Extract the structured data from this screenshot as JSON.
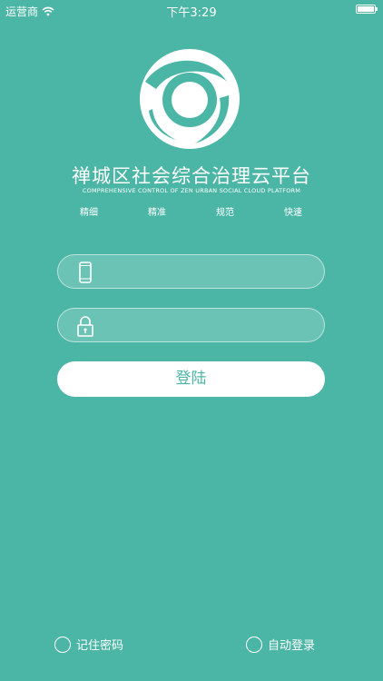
{
  "status_bar": {
    "carrier": "运营商",
    "time": "下午3:29",
    "icons": [
      "wifi-icon",
      "battery-icon"
    ]
  },
  "header": {
    "logo_icon": "eye-swirl-logo",
    "title": "禅城区社会综合治理云平台",
    "subtitle": "COMPREHENSIVE CONTROL OF ZEN URBAN SOCIAL CLOUD PLATFORM",
    "taglines": [
      "精细",
      "精准",
      "规范",
      "快速"
    ]
  },
  "form": {
    "phone": {
      "icon": "phone-icon",
      "value": "",
      "placeholder": ""
    },
    "password": {
      "icon": "lock-icon",
      "value": "",
      "placeholder": ""
    },
    "login_label": "登陆"
  },
  "options": {
    "remember_password": "记住密码",
    "auto_login": "自动登录"
  },
  "colors": {
    "background": "#4bb6a5",
    "accent": "#4bb6a5",
    "foreground": "#ffffff"
  }
}
